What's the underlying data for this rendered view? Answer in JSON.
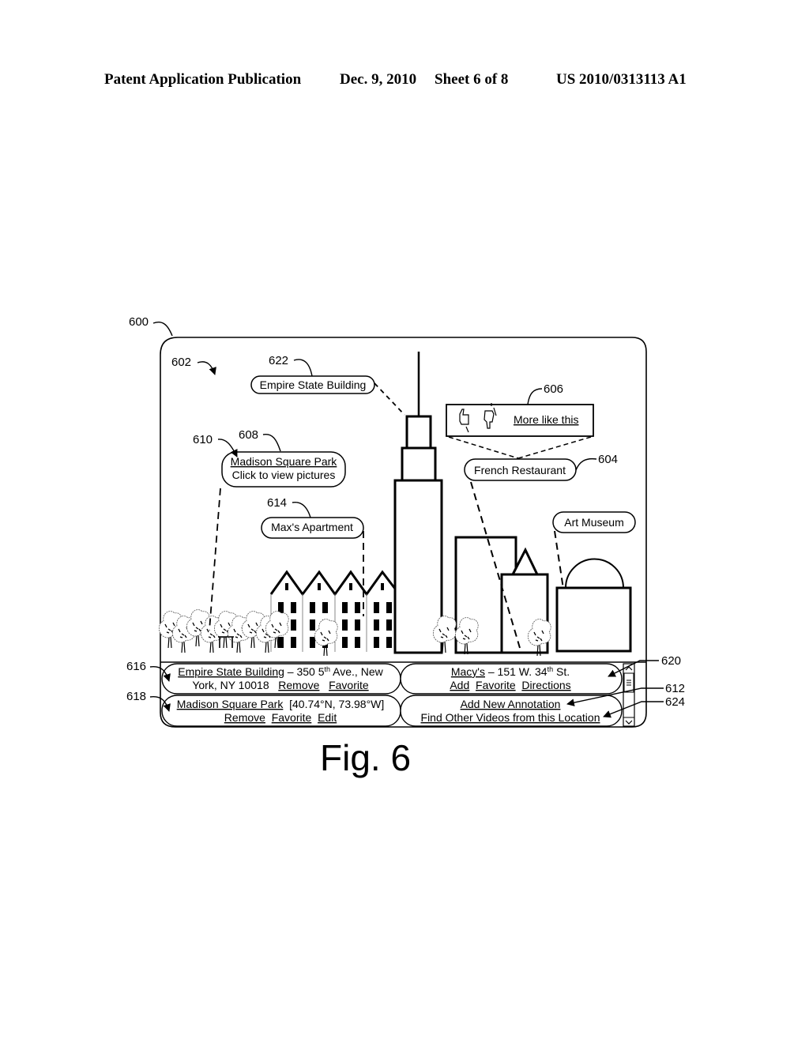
{
  "header": {
    "publication": "Patent Application Publication",
    "date": "Dec. 9, 2010",
    "sheet": "Sheet 6 of 8",
    "number": "US 2010/0313113 A1"
  },
  "figure": {
    "caption": "Fig. 6",
    "reference_numerals": {
      "device": "600",
      "video_view": "602",
      "french_restaurant": "604",
      "rating_popup": "606",
      "madison_park_label": "608",
      "cursor": "610",
      "add_annotation": "612",
      "max_apartment": "614",
      "list_item_1": "616",
      "list_item_2": "618",
      "list_item_3": "620",
      "empire_label": "622",
      "find_videos": "624"
    },
    "scene_labels": {
      "empire_state": "Empire State Building",
      "madison_park_title": "Madison Square Park",
      "madison_park_sub": "Click to view pictures",
      "max_apartment": "Max's Apartment",
      "french_restaurant": "French Restaurant",
      "art_museum": "Art Museum",
      "more_like_this": "More like this"
    },
    "rating_icons": [
      "thumbs-up-icon",
      "thumbs-down-icon"
    ],
    "annotation_list": {
      "item1": {
        "title": "Empire State Building",
        "addr_a": " – 350 5",
        "addr_sup": "th",
        "addr_b": " Ave., New",
        "line2": "York, NY 10018",
        "actions": [
          "Remove",
          "Favorite"
        ]
      },
      "item2": {
        "title": "Madison Square Park",
        "coords": "[40.74°N, 73.98°W]",
        "actions": [
          "Remove",
          "Favorite",
          "Edit"
        ]
      },
      "item3": {
        "title": "Macy's",
        "addr_a": " – 151 W. 34",
        "addr_sup": "th",
        "addr_b": " St.",
        "actions": [
          "Add",
          "Favorite",
          "Directions"
        ]
      },
      "item4": {
        "line1": "Add New Annotation",
        "line2": "Find Other Videos from this Location"
      }
    }
  }
}
